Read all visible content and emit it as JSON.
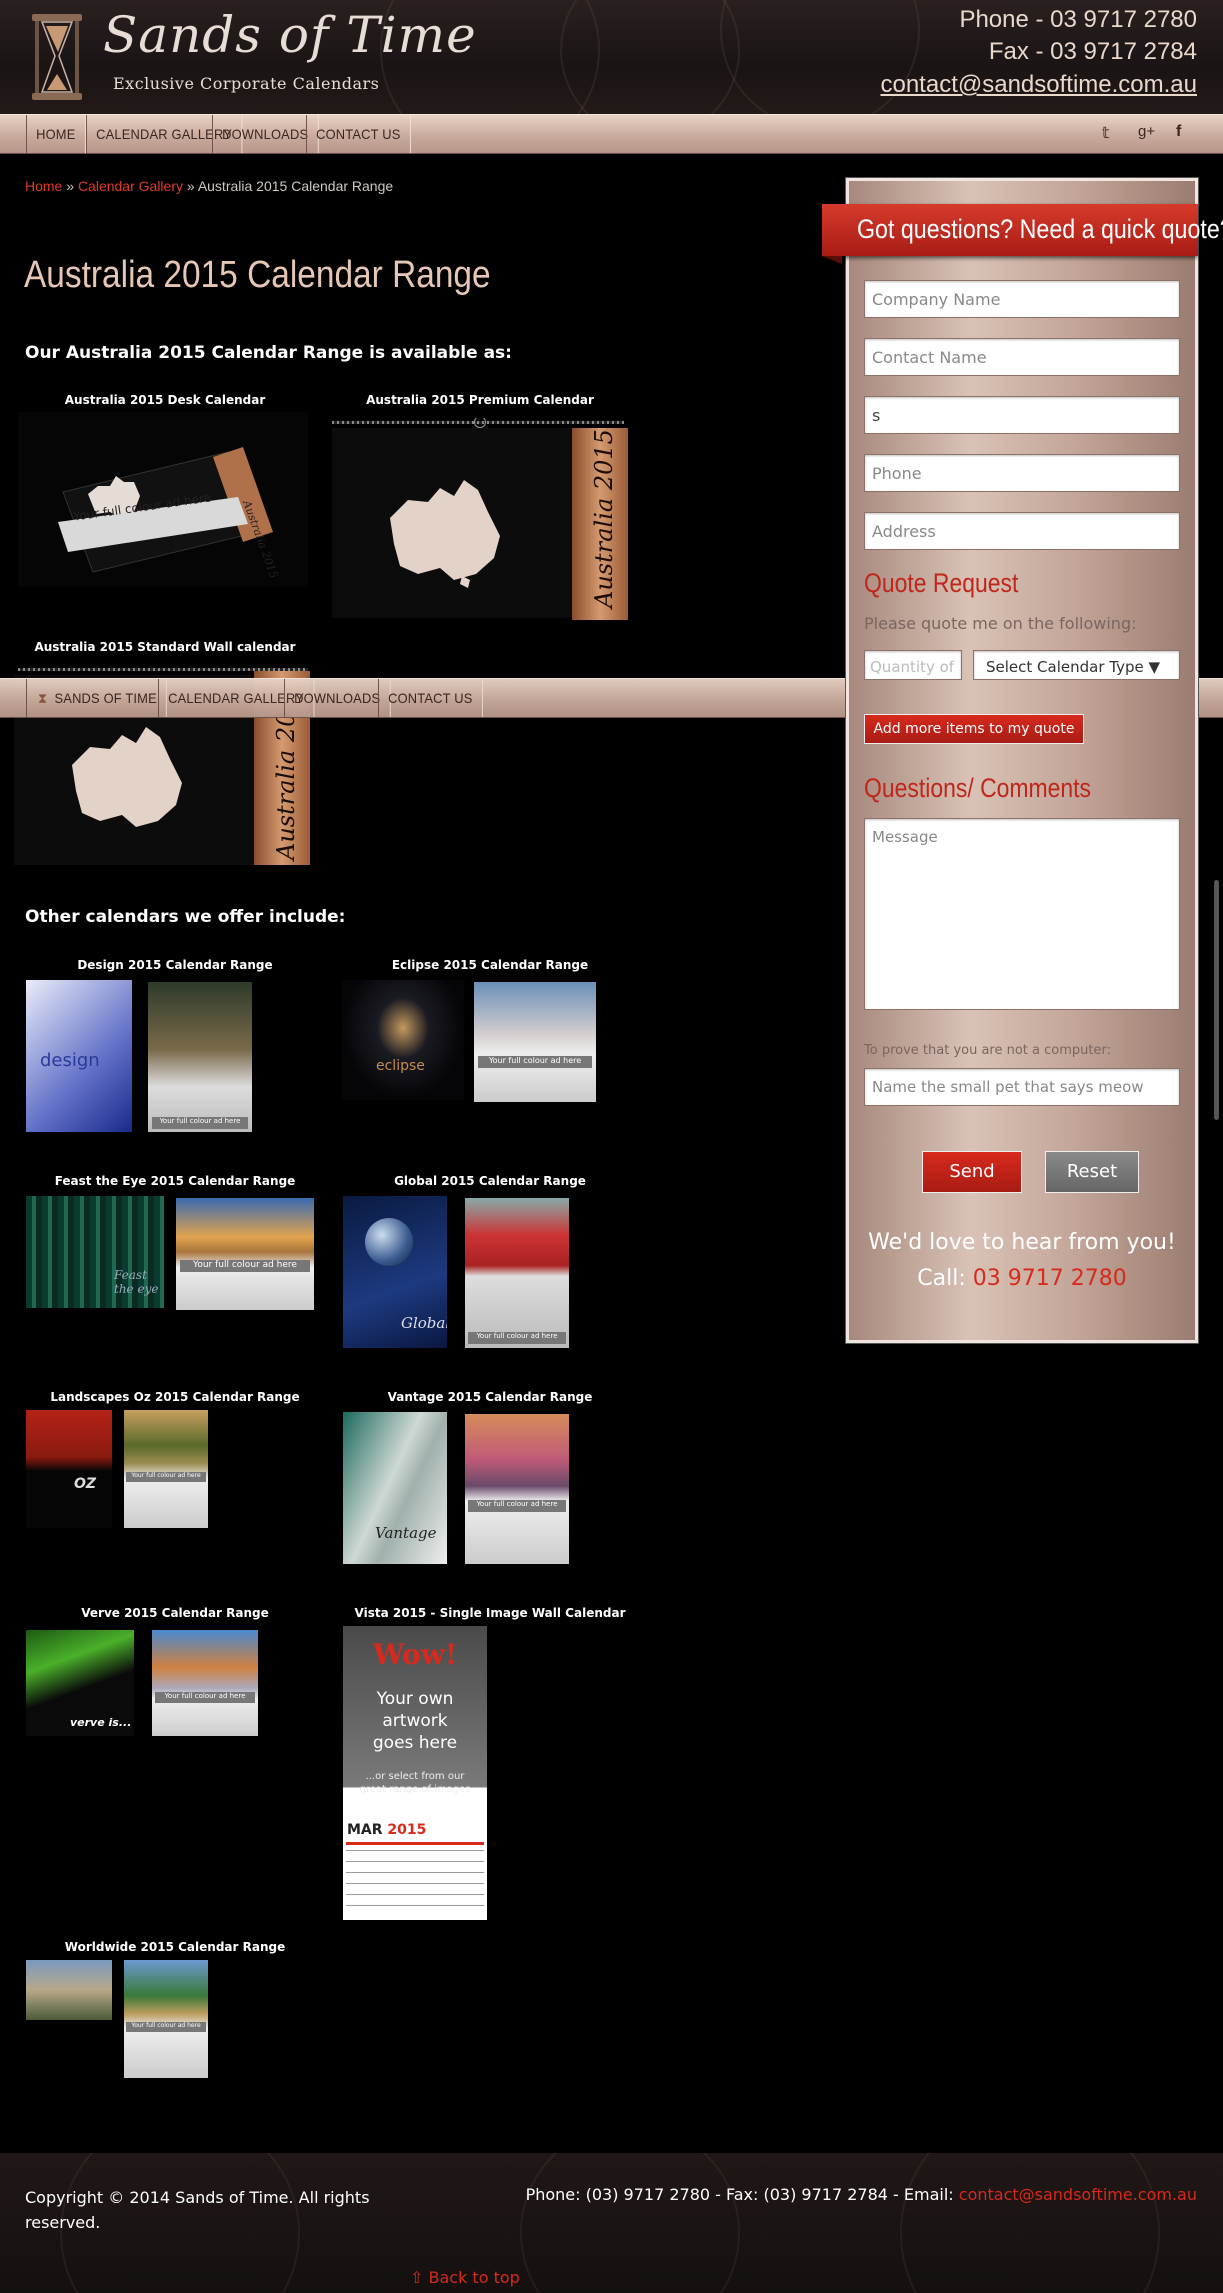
{
  "header": {
    "logo_title": "Sands of Time",
    "logo_subtitle": "Exclusive Corporate Calendars",
    "phone": "Phone - 03 9717 2780",
    "fax": "Fax - 03 9717 2784",
    "email": "contact@sandsoftime.com.au"
  },
  "nav": {
    "items": [
      "HOME",
      "CALENDAR GALLERY",
      "DOWNLOADS",
      "CONTACT US"
    ],
    "sticky_items": [
      "SANDS OF TIME",
      "CALENDAR GALLERY",
      "DOWNLOADS",
      "CONTACT US"
    ],
    "social": [
      "twitter-icon",
      "google-plus-icon",
      "facebook-icon"
    ]
  },
  "breadcrumb": {
    "home": "Home",
    "sep": "»",
    "gallery": "Calendar Gallery",
    "current": "Australia 2015 Calendar Range"
  },
  "main": {
    "title": "Australia 2015 Calendar Range",
    "intro": "Our Australia 2015 Calendar Range is available as:",
    "products": [
      {
        "caption": "Australia 2015 Desk Calendar",
        "ad_text": "Your full colour ad here"
      },
      {
        "caption": "Australia 2015 Premium Calendar",
        "spine_text": "Australia 2015"
      },
      {
        "caption": "Australia 2015 Standard Wall calendar",
        "spine_text": "Australia 20"
      }
    ],
    "other_title": "Other calendars we offer include:",
    "ranges": [
      {
        "caption": "Design 2015 Calendar Range",
        "label": "design"
      },
      {
        "caption": "Eclipse 2015 Calendar Range",
        "label": "eclipse"
      },
      {
        "caption": "Feast the Eye 2015 Calendar Range",
        "label": "Feast the eye"
      },
      {
        "caption": "Global 2015 Calendar Range",
        "label": "Global"
      },
      {
        "caption": "Landscapes Oz 2015 Calendar Range",
        "label": "OZ"
      },
      {
        "caption": "Vantage 2015 Calendar Range",
        "label": "Vantage"
      },
      {
        "caption": "Verve 2015 Calendar Range",
        "label": "verve is..."
      },
      {
        "caption": "Vista 2015 - Single Image Wall Calendar",
        "label": "Wow!"
      },
      {
        "caption": "Worldwide 2015 Calendar Range",
        "label": ""
      }
    ],
    "ad_text": "Your full colour ad here",
    "vista": {
      "wow": "Wow!",
      "line1": "Your own",
      "line2": "artwork",
      "line3": "goes here",
      "small1": "...or select from our",
      "small2": "great range of images",
      "month": "MAR",
      "year": "2015"
    }
  },
  "sidebar": {
    "banner": "Got questions? Need a quick quote?",
    "company_placeholder": "Company Name",
    "contact_placeholder": "Contact Name",
    "email_value": "s",
    "phone_placeholder": "Phone",
    "address_placeholder": "Address",
    "quote_heading": "Quote Request",
    "quote_sub": "Please quote me on the following:",
    "quantity_placeholder": "Quantity of",
    "type_select": "Select Calendar Type ▼",
    "add_more": "Add more items to my quote",
    "comments_heading": "Questions/ Comments",
    "message_placeholder": "Message",
    "captcha_label": "To prove that you are not a computer:",
    "captcha_placeholder": "Name the small pet that says meow",
    "send": "Send",
    "reset": "Reset",
    "love": "We'd love to hear from you!",
    "call_label": "Call:",
    "call_number": "03 9717 2780"
  },
  "footer": {
    "copyright_line1": "Copyright © 2014 Sands of Time. All rights",
    "copyright_line2": "reserved.",
    "contact_text": "Phone: (03) 9717 2780 - Fax: (03) 9717 2784 - Email:",
    "email": "contact@sandsoftime.com.au",
    "back_to_top": "⇧ Back to top"
  },
  "colors": {
    "accent_red": "#d8291c",
    "title_peach": "#e6c6b5",
    "nav_bg": "#c9ab9d"
  }
}
